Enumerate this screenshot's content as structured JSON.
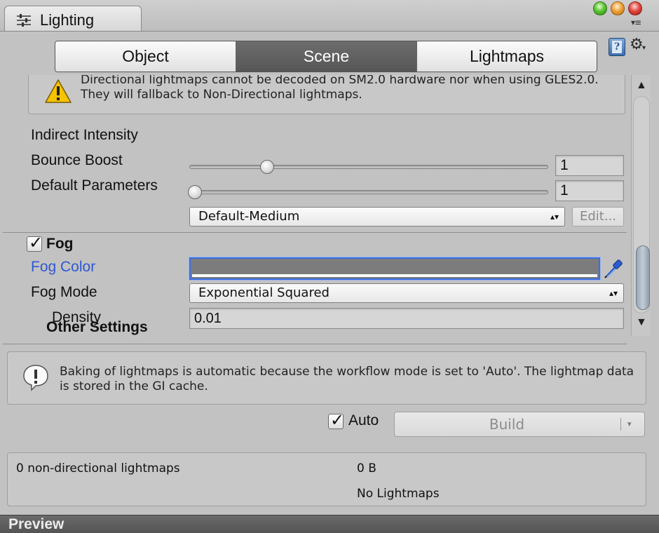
{
  "window": {
    "tab_title": "Lighting",
    "menu_glyph": "▾≡"
  },
  "toolbar": {
    "help_glyph": "?",
    "gear_glyph": "⚙",
    "gear_caret": "▾"
  },
  "mode_tabs": [
    {
      "label": "Object",
      "active": false
    },
    {
      "label": "Scene",
      "active": true
    },
    {
      "label": "Lightmaps",
      "active": false
    }
  ],
  "warning": {
    "icon": "warning-triangle-icon",
    "text": "Directional lightmaps cannot be decoded on SM2.0 hardware nor when using GLES2.0. They will fallback to Non-Directional lightmaps."
  },
  "indirect_intensity": {
    "label": "Indirect Intensity",
    "value": "1",
    "slider_fraction": 0.21
  },
  "bounce_boost": {
    "label": "Bounce Boost",
    "value": "1",
    "slider_fraction": 0.0
  },
  "default_parameters": {
    "label": "Default Parameters",
    "selected": "Default-Medium",
    "edit_label": "Edit..."
  },
  "fog": {
    "label": "Fog",
    "enabled": true,
    "color_label": "Fog Color",
    "color_value": "#7c7c7c",
    "mode_label": "Fog Mode",
    "mode_selected": "Exponential Squared",
    "density_label": "Density",
    "density_value": "0.01"
  },
  "other_settings": {
    "title": "Other Settings"
  },
  "info": {
    "icon": "info-exclamation-icon",
    "text": "Baking of lightmaps is automatic because the workflow mode is set to 'Auto'. The lightmap data is stored in the GI cache."
  },
  "build": {
    "auto_label": "Auto",
    "auto_checked": true,
    "build_label": "Build",
    "build_arrow": "▾"
  },
  "stats": {
    "count_label": "0 non-directional lightmaps",
    "size": "0 B",
    "status": "No Lightmaps"
  },
  "preview": {
    "label": "Preview"
  },
  "scrollbar": {
    "up": "▲",
    "down": "▼"
  },
  "colors": {
    "accent_blue": "#2f58d0",
    "active_tab": "#5f5f5f",
    "panel_bg": "#c2c2c2"
  }
}
